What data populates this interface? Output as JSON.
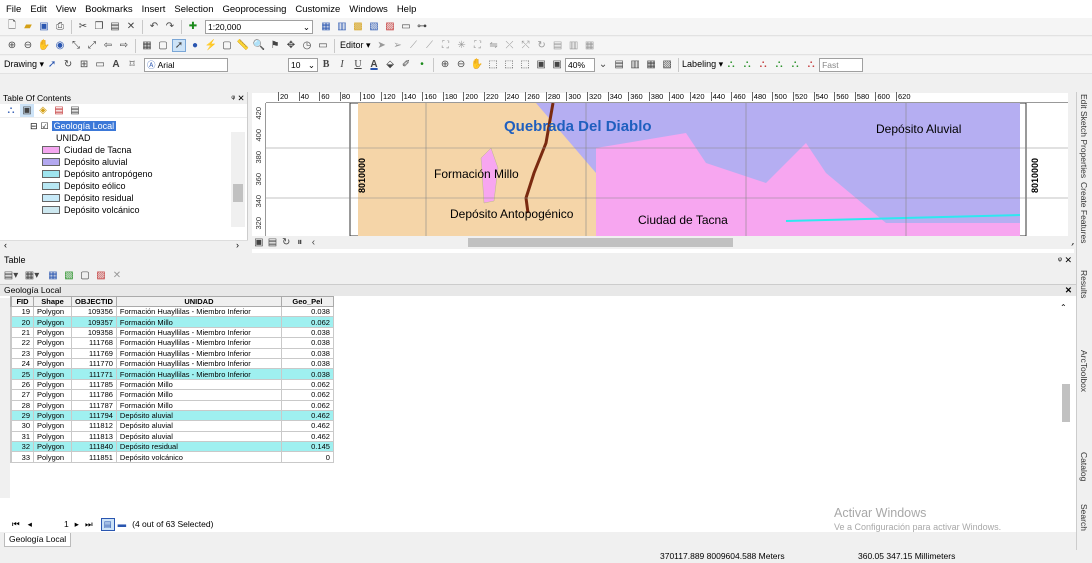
{
  "menu": [
    "File",
    "Edit",
    "View",
    "Bookmarks",
    "Insert",
    "Selection",
    "Geoprocessing",
    "Customize",
    "Windows",
    "Help"
  ],
  "toolbar": {
    "scale": "1:20,000",
    "editor": "Editor",
    "drawing": "Drawing",
    "font": "Arial",
    "font_size": "10",
    "zoom": "40%",
    "labeling": "Labeling",
    "fast": "Fast"
  },
  "toc": {
    "title": "Table Of Contents",
    "layer": "Geología Local",
    "field": "UNIDAD",
    "legend": [
      {
        "label": "Ciudad de Tacna",
        "color": "#f4a7f0"
      },
      {
        "label": "Depósito aluvial",
        "color": "#b3a8f0"
      },
      {
        "label": "Depósito antropógeno",
        "color": "#9fe5ef"
      },
      {
        "label": "Depósito eólico",
        "color": "#b8e8f4"
      },
      {
        "label": "Depósito residual",
        "color": "#c8eaf8"
      },
      {
        "label": "Depósito volcánico",
        "color": "#cde8f0"
      }
    ]
  },
  "map": {
    "ruler": [
      "20",
      "40",
      "60",
      "80",
      "100",
      "120",
      "140",
      "160",
      "180",
      "200",
      "220",
      "240",
      "260",
      "280",
      "300",
      "320",
      "340",
      "360",
      "380",
      "400",
      "420",
      "440",
      "460",
      "480",
      "500",
      "520",
      "540",
      "560",
      "580",
      "600",
      "620"
    ],
    "vruler": [
      "420",
      "400",
      "380",
      "360",
      "340",
      "320"
    ],
    "northing": "8010000",
    "labels": {
      "title": "Quebrada Del Diablo",
      "aluvial": "Depósito Aluvial",
      "millo": "Formación Millo",
      "antro": "Depósito Antopogénico",
      "tacna": "Ciudad de Tacna"
    },
    "colors": {
      "tan": "#f5d5a8",
      "aluvial": "#b5aef2",
      "tacna": "#f7a6f0",
      "channel": "#7a2a10",
      "cyan": "#2ee8f0"
    }
  },
  "table": {
    "title": "Table",
    "layer": "Geología Local",
    "headers": [
      "FID",
      "Shape",
      "OBJECTID",
      "UNIDAD",
      "Geo_Pel"
    ],
    "rows": [
      {
        "fid": "19",
        "shape": "Polygon",
        "oid": "109356",
        "unidad": "Formación Huayllilas - Miembro Inferior",
        "geo": "0.038",
        "sel": false
      },
      {
        "fid": "20",
        "shape": "Polygon",
        "oid": "109357",
        "unidad": "Formación Millo",
        "geo": "0.062",
        "sel": true
      },
      {
        "fid": "21",
        "shape": "Polygon",
        "oid": "109358",
        "unidad": "Formación Huayllilas - Miembro Inferior",
        "geo": "0.038",
        "sel": false
      },
      {
        "fid": "22",
        "shape": "Polygon",
        "oid": "111768",
        "unidad": "Formación Huayllilas - Miembro Inferior",
        "geo": "0.038",
        "sel": false
      },
      {
        "fid": "23",
        "shape": "Polygon",
        "oid": "111769",
        "unidad": "Formación Huayllilas - Miembro Inferior",
        "geo": "0.038",
        "sel": false
      },
      {
        "fid": "24",
        "shape": "Polygon",
        "oid": "111770",
        "unidad": "Formación Huayllilas - Miembro Inferior",
        "geo": "0.038",
        "sel": false
      },
      {
        "fid": "25",
        "shape": "Polygon",
        "oid": "111771",
        "unidad": "Formación Huayllilas - Miembro Inferior",
        "geo": "0.038",
        "sel": true
      },
      {
        "fid": "26",
        "shape": "Polygon",
        "oid": "111785",
        "unidad": "Formación Millo",
        "geo": "0.062",
        "sel": false
      },
      {
        "fid": "27",
        "shape": "Polygon",
        "oid": "111786",
        "unidad": "Formación Millo",
        "geo": "0.062",
        "sel": false
      },
      {
        "fid": "28",
        "shape": "Polygon",
        "oid": "111787",
        "unidad": "Formación Millo",
        "geo": "0.062",
        "sel": false
      },
      {
        "fid": "29",
        "shape": "Polygon",
        "oid": "111794",
        "unidad": "Depósito aluvial",
        "geo": "0.462",
        "sel": true
      },
      {
        "fid": "30",
        "shape": "Polygon",
        "oid": "111812",
        "unidad": "Depósito aluvial",
        "geo": "0.462",
        "sel": false
      },
      {
        "fid": "31",
        "shape": "Polygon",
        "oid": "111813",
        "unidad": "Depósito aluvial",
        "geo": "0.462",
        "sel": false
      },
      {
        "fid": "32",
        "shape": "Polygon",
        "oid": "111840",
        "unidad": "Depósito residual",
        "geo": "0.145",
        "sel": true
      },
      {
        "fid": "33",
        "shape": "Polygon",
        "oid": "111851",
        "unidad": "Depósito volcánico",
        "geo": "0",
        "sel": false
      }
    ],
    "record": "1",
    "selected": "(4 out of 63 Selected)",
    "tab": "Geología Local"
  },
  "activation": {
    "title": "Activar Windows",
    "subtitle": "Ve a Configuración para activar Windows."
  },
  "dock": [
    "Edit Sketch Properties",
    "Create Features",
    "Results",
    "ArcToolbox",
    "Catalog",
    "Search"
  ],
  "status": {
    "coords": "370117.889 8009604.588 Meters",
    "page": "360.05  347.15 Millimeters"
  }
}
